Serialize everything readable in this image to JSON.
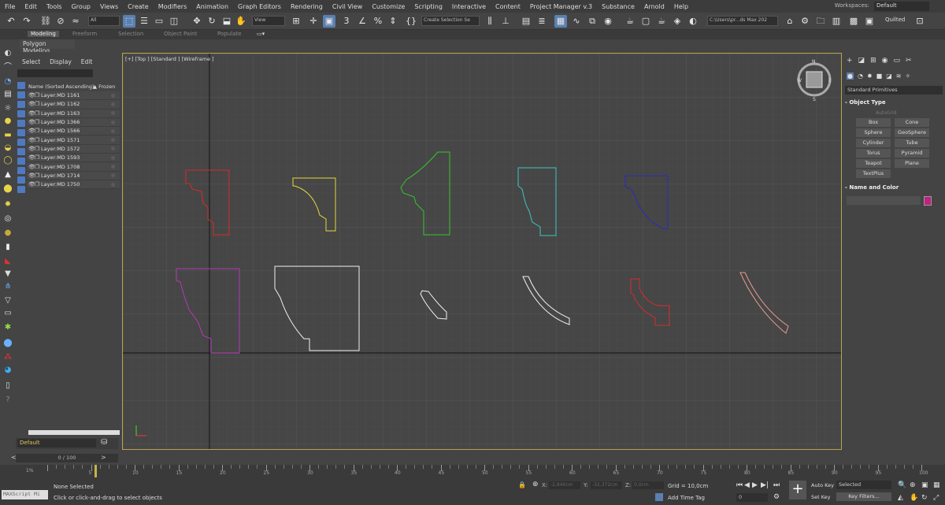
{
  "menubar": {
    "items": [
      "File",
      "Edit",
      "Tools",
      "Group",
      "Views",
      "Create",
      "Modifiers",
      "Animation",
      "Graph Editors",
      "Rendering",
      "Civil View",
      "Customize",
      "Scripting",
      "Interactive",
      "Content",
      "Project Manager v.3",
      "Substance",
      "Arnold",
      "Help"
    ],
    "workspaces_label": "Workspaces:",
    "workspace_value": "Default"
  },
  "toolbar": {
    "filter_value": "All",
    "refcoord_value": "View",
    "snap_label": "3",
    "named_selection_placeholder": "Create Selection Se",
    "project_path": "C:\\Users\\pr...ds Max 202",
    "quilted_label": "Quilted"
  },
  "ribbon": {
    "tabs": [
      "Modeling",
      "Freeform",
      "Selection",
      "Object Paint",
      "Populate"
    ],
    "active_tab": "Modeling",
    "sub_label": "Polygon Modeling"
  },
  "explorer": {
    "menu": [
      "Select",
      "Display",
      "Edit"
    ],
    "column_name": "Name (Sorted Ascending)",
    "column_frozen": "▲ Frozen",
    "layers": [
      "Layer:MD 1161",
      "Layer:MD 1162",
      "Layer:MD 1163",
      "Layer:MD 1366",
      "Layer:MD 1566",
      "Layer:MD 1571",
      "Layer:MD 1572",
      "Layer:MD 1593",
      "Layer:MD 1708",
      "Layer:MD 1714",
      "Layer:MD 1750"
    ],
    "layer_dropdown": "Default"
  },
  "viewport": {
    "label": "[+] [Top ] [Standard ] [Wireframe ]",
    "colors": {
      "red": "#d62b2b",
      "yellow": "#e6d63a",
      "green": "#35c42f",
      "cyan": "#3ec6c2",
      "blue": "#2a2ab8",
      "magenta": "#b43ab8",
      "white": "#f0f0f0",
      "salmon": "#e89a8e"
    }
  },
  "command_panel": {
    "dropdown": "Standard Primitives",
    "object_type_title": "Object Type",
    "autogrid": "AutoGrid",
    "primitives": [
      "Box",
      "Cone",
      "Sphere",
      "GeoSphere",
      "Cylinder",
      "Tube",
      "Torus",
      "Pyramid",
      "Teapot",
      "Plane",
      "TextPlus"
    ],
    "name_color_title": "Name and Color",
    "object_color": "#c2217d"
  },
  "timeline": {
    "slider": "0 / 100",
    "ruler_labels": [
      "5",
      "10",
      "15",
      "20",
      "25",
      "30",
      "35",
      "40",
      "45",
      "50",
      "55",
      "60",
      "65",
      "70",
      "75",
      "80",
      "85",
      "90",
      "95",
      "100"
    ],
    "percent_label": "1%"
  },
  "statusbar": {
    "maxscript": "MAXScript Mi",
    "selection": "None Selected",
    "prompt": "Click or click-and-drag to select objects",
    "x_label": "X:",
    "x_value": "-2,840cm",
    "y_label": "Y:",
    "y_value": "-32,372cm",
    "z_label": "Z:",
    "z_value": "0,0cm",
    "grid": "Grid = 10,0cm",
    "add_time_tag": "Add Time Tag",
    "frame": "0",
    "auto_key": "Auto Key",
    "set_key": "Set Key",
    "selected_dd": "Selected",
    "key_filters": "Key Filters..."
  }
}
